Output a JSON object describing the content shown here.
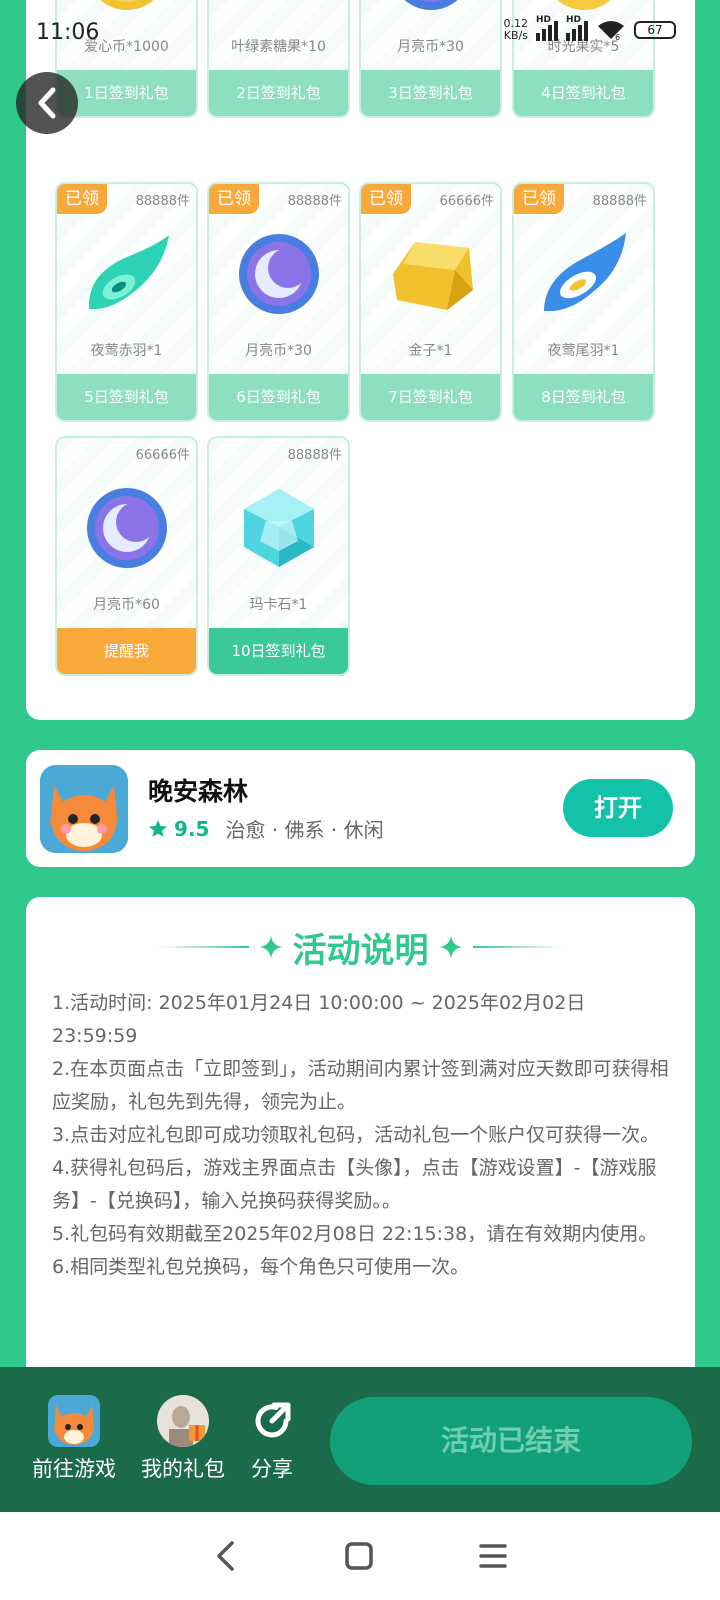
{
  "status": {
    "time": "11:06",
    "net_speed_value": "0.12",
    "net_speed_unit": "KB/s",
    "signal1_label": "HD",
    "signal2_label": "HD",
    "wifi_badge": "6",
    "battery": "67"
  },
  "gifts": [
    {
      "name": "爱心币*1000",
      "button": "1日签到礼包",
      "icon": "heart-coin-icon"
    },
    {
      "name": "叶绿素糖果*10",
      "button": "2日签到礼包",
      "icon": "leaf-candy-icon"
    },
    {
      "name": "月亮币*30",
      "button": "3日签到礼包",
      "icon": "moon-coin-icon"
    },
    {
      "name": "时光果实*5",
      "button": "4日签到礼包",
      "icon": "time-fruit-icon"
    },
    {
      "name": "夜莺赤羽*1",
      "button": "5日签到礼包",
      "claimed": "已领",
      "qty": "88888件",
      "icon": "nightingale-feather-icon"
    },
    {
      "name": "月亮币*30",
      "button": "6日签到礼包",
      "claimed": "已领",
      "qty": "88888件",
      "icon": "moon-coin-icon"
    },
    {
      "name": "金子*1",
      "button": "7日签到礼包",
      "claimed": "已领",
      "qty": "66666件",
      "icon": "gold-block-icon"
    },
    {
      "name": "夜莺尾羽*1",
      "button": "8日签到礼包",
      "claimed": "已领",
      "qty": "88888件",
      "icon": "blue-feather-icon"
    },
    {
      "name": "月亮币*60",
      "button": "提醒我",
      "qty": "66666件",
      "icon": "moon-coin-icon"
    },
    {
      "name": "玛卡石*1",
      "button": "10日签到礼包",
      "qty": "88888件",
      "icon": "crystal-stone-icon"
    }
  ],
  "app": {
    "name": "晚安森林",
    "rating": "9.5",
    "tags": "治愈 · 佛系 · 休闲",
    "open_label": "打开"
  },
  "rules": {
    "title": "活动说明",
    "lines": [
      "1.活动时间: 2025年01月24日 10:00:00 ~ 2025年02月02日 23:59:59",
      "2.在本页面点击「立即签到」，活动期间内累计签到满对应天数即可获得相应奖励，礼包先到先得，领完为止。",
      "3.点击对应礼包即可成功领取礼包码，活动礼包一个账户仅可获得一次。",
      "4.获得礼包码后，游戏主界面点击【头像】，点击【游戏设置】-【游戏服务】-【兑换码】，输入兑换码获得奖励。。",
      "5.礼包码有效期截至2025年02月08日 22:15:38，请在有效期内使用。",
      "6.相同类型礼包兑换码，每个角色只可使用一次。"
    ]
  },
  "bottom": {
    "go_game": "前往游戏",
    "my_gifts": "我的礼包",
    "share": "分享",
    "ended": "活动已结束"
  },
  "colors": {
    "primary": "#2fc98c",
    "dark_bar": "#1b6b4b",
    "claimed_orange": "#f7a93c",
    "button_mint": "#8ddfbf",
    "open_teal": "#12c2a9"
  }
}
